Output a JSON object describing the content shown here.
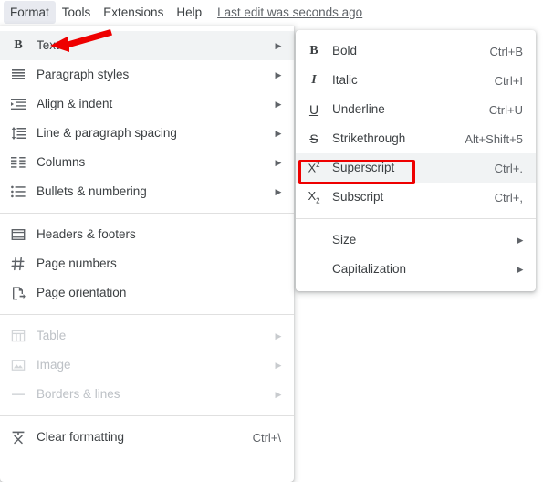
{
  "menubar": {
    "items": [
      {
        "label": "Format",
        "active": true
      },
      {
        "label": "Tools",
        "active": false
      },
      {
        "label": "Extensions",
        "active": false
      },
      {
        "label": "Help",
        "active": false
      }
    ],
    "last_edit": "Last edit was seconds ago"
  },
  "format_menu": {
    "groups": [
      {
        "items": [
          {
            "label": "Text",
            "icon": "bold-b-icon",
            "submenu": true,
            "highlighted": true,
            "disabled": false,
            "shortcut": ""
          },
          {
            "label": "Paragraph styles",
            "icon": "paragraph-styles-icon",
            "submenu": true,
            "highlighted": false,
            "disabled": false,
            "shortcut": ""
          },
          {
            "label": "Align & indent",
            "icon": "align-indent-icon",
            "submenu": true,
            "highlighted": false,
            "disabled": false,
            "shortcut": ""
          },
          {
            "label": "Line & paragraph spacing",
            "icon": "line-spacing-icon",
            "submenu": true,
            "highlighted": false,
            "disabled": false,
            "shortcut": ""
          },
          {
            "label": "Columns",
            "icon": "columns-icon",
            "submenu": true,
            "highlighted": false,
            "disabled": false,
            "shortcut": ""
          },
          {
            "label": "Bullets & numbering",
            "icon": "bullets-numbering-icon",
            "submenu": true,
            "highlighted": false,
            "disabled": false,
            "shortcut": ""
          }
        ]
      },
      {
        "items": [
          {
            "label": "Headers & footers",
            "icon": "headers-footers-icon",
            "submenu": false,
            "highlighted": false,
            "disabled": false,
            "shortcut": ""
          },
          {
            "label": "Page numbers",
            "icon": "page-numbers-icon",
            "submenu": false,
            "highlighted": false,
            "disabled": false,
            "shortcut": ""
          },
          {
            "label": "Page orientation",
            "icon": "page-orientation-icon",
            "submenu": false,
            "highlighted": false,
            "disabled": false,
            "shortcut": ""
          }
        ]
      },
      {
        "items": [
          {
            "label": "Table",
            "icon": "table-icon",
            "submenu": true,
            "highlighted": false,
            "disabled": true,
            "shortcut": ""
          },
          {
            "label": "Image",
            "icon": "image-icon",
            "submenu": true,
            "highlighted": false,
            "disabled": true,
            "shortcut": ""
          },
          {
            "label": "Borders & lines",
            "icon": "borders-lines-icon",
            "submenu": true,
            "highlighted": false,
            "disabled": true,
            "shortcut": ""
          }
        ]
      },
      {
        "items": [
          {
            "label": "Clear formatting",
            "icon": "clear-formatting-icon",
            "submenu": false,
            "highlighted": false,
            "disabled": false,
            "shortcut": "Ctrl+\\"
          }
        ]
      }
    ]
  },
  "text_submenu": {
    "groups": [
      {
        "items": [
          {
            "label": "Bold",
            "icon": "bold-icon",
            "shortcut": "Ctrl+B",
            "submenu": false,
            "highlighted": false
          },
          {
            "label": "Italic",
            "icon": "italic-icon",
            "shortcut": "Ctrl+I",
            "submenu": false,
            "highlighted": false
          },
          {
            "label": "Underline",
            "icon": "underline-icon",
            "shortcut": "Ctrl+U",
            "submenu": false,
            "highlighted": false
          },
          {
            "label": "Strikethrough",
            "icon": "strikethrough-icon",
            "shortcut": "Alt+Shift+5",
            "submenu": false,
            "highlighted": false
          },
          {
            "label": "Superscript",
            "icon": "superscript-icon",
            "shortcut": "Ctrl+.",
            "submenu": false,
            "highlighted": true
          },
          {
            "label": "Subscript",
            "icon": "subscript-icon",
            "shortcut": "Ctrl+,",
            "submenu": false,
            "highlighted": false
          }
        ]
      },
      {
        "items": [
          {
            "label": "Size",
            "icon": "",
            "shortcut": "",
            "submenu": true,
            "highlighted": false
          },
          {
            "label": "Capitalization",
            "icon": "",
            "shortcut": "",
            "submenu": true,
            "highlighted": false
          }
        ]
      }
    ]
  },
  "annotations": {
    "highlight_color": "#ee0000",
    "highlight_target": "Superscript",
    "arrow_color": "#ee0000",
    "arrow_target": "Text"
  }
}
